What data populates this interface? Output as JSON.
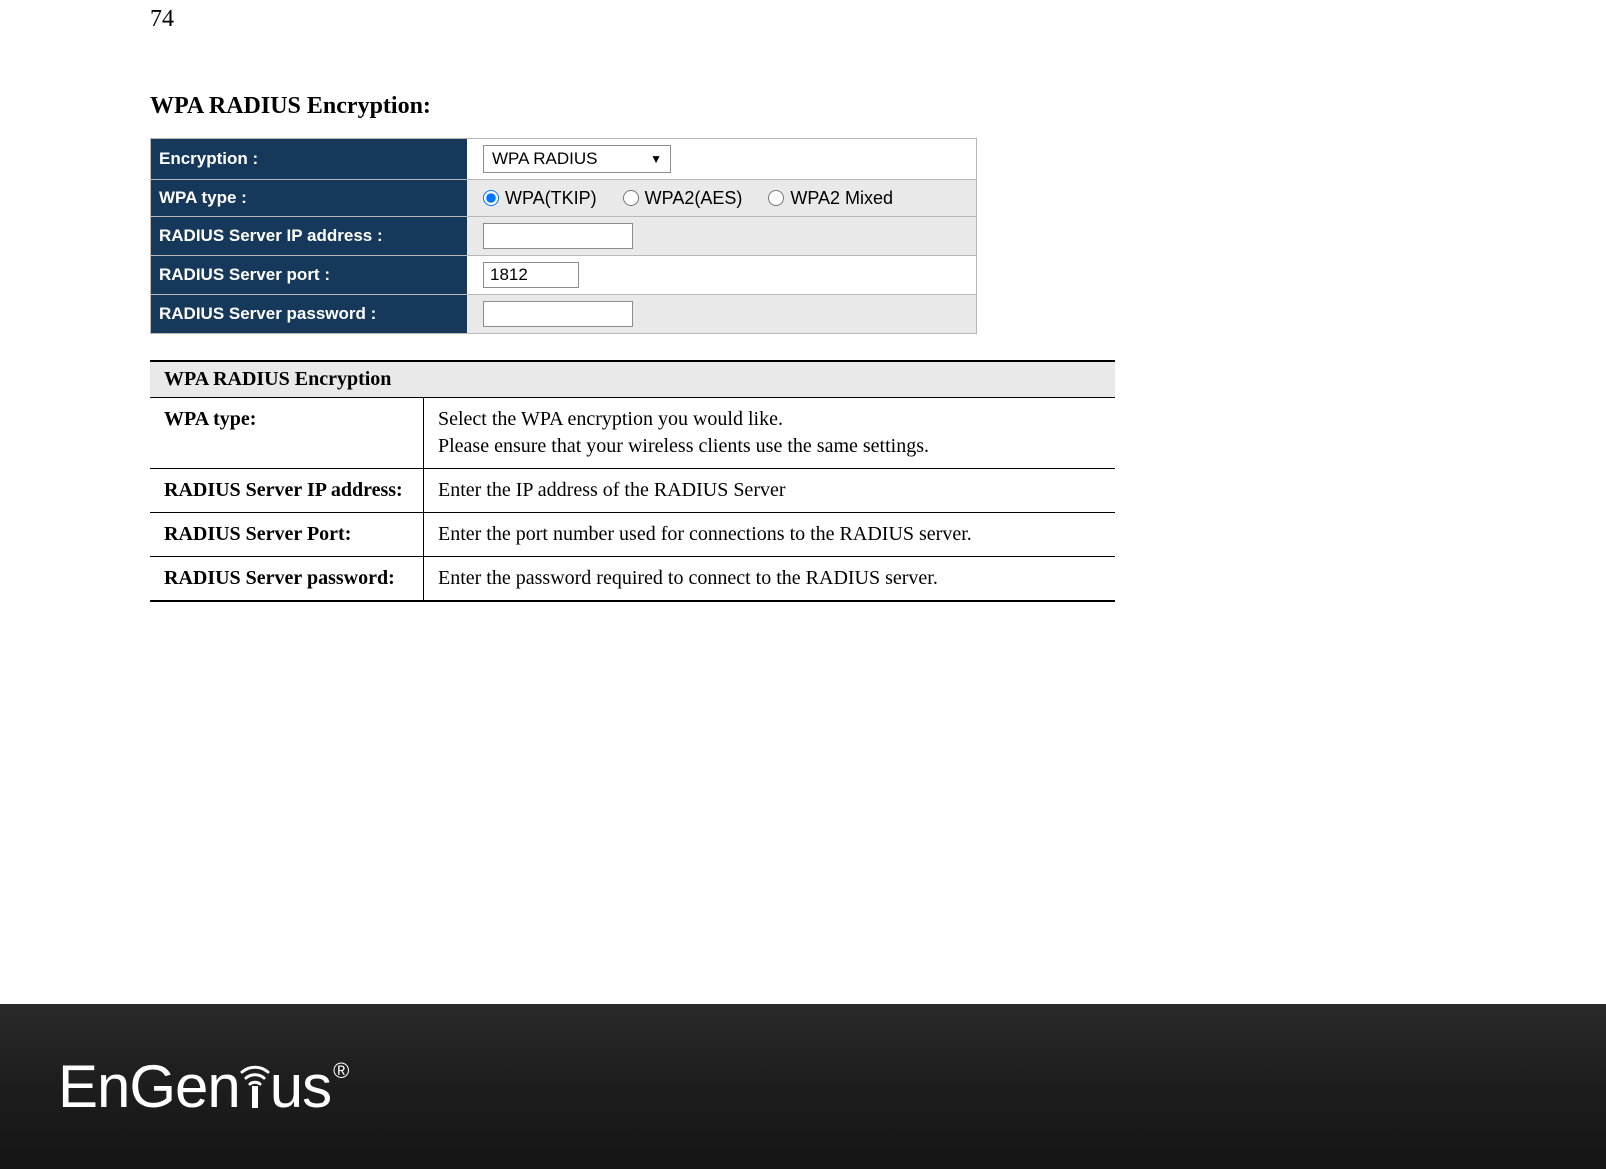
{
  "page_number": "74",
  "section_heading": "WPA RADIUS Encryption:",
  "settings": {
    "rows": {
      "encryption": {
        "label": "Encryption :",
        "value": "WPA RADIUS"
      },
      "wpa_type": {
        "label": "WPA type :",
        "options": [
          "WPA(TKIP)",
          "WPA2(AES)",
          "WPA2 Mixed"
        ],
        "selected": "WPA(TKIP)"
      },
      "radius_ip": {
        "label": "RADIUS Server IP address :",
        "value": ""
      },
      "radius_port": {
        "label": "RADIUS Server port :",
        "value": "1812"
      },
      "radius_pw": {
        "label": "RADIUS Server password :",
        "value": ""
      }
    }
  },
  "desc_table": {
    "header": "WPA RADIUS Encryption",
    "rows": [
      {
        "label": "WPA type:",
        "desc": "Select the WPA encryption you would like.\nPlease ensure that your wireless clients use the same settings."
      },
      {
        "label": "RADIUS Server IP address:",
        "desc": "Enter the IP address of the RADIUS Server"
      },
      {
        "label": "RADIUS Server Port:",
        "desc": "Enter the port number used for connections to the RADIUS server."
      },
      {
        "label": "RADIUS Server password:",
        "desc": "Enter the password required to connect to the RADIUS server."
      }
    ]
  },
  "footer": {
    "brand": "EnGenius",
    "reg": "®"
  }
}
